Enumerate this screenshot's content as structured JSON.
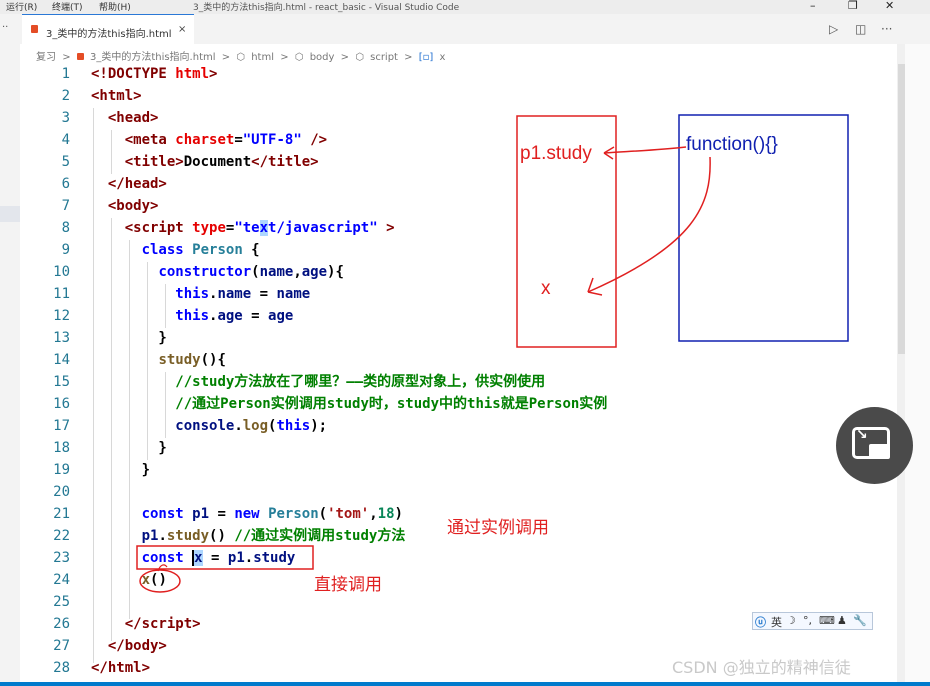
{
  "window": {
    "menu": [
      "运行(R)",
      "终端(T)",
      "帮助(H)"
    ],
    "title": "3_类中的方法this指向.html - react_basic - Visual Studio Code"
  },
  "tab": {
    "label": "3_类中的方法this指向.html",
    "close": "×"
  },
  "breadcrumb": [
    "复习",
    ">",
    "3_类中的方法this指向.html",
    ">",
    "html",
    ">",
    "body",
    ">",
    "script",
    ">",
    "x"
  ],
  "code_lines": [
    {
      "n": "1",
      "html": "<span class='t'>&lt;!DOCTYPE </span><span class='a'>html</span><span class='t'>&gt;</span>"
    },
    {
      "n": "2",
      "html": "<span class='t'>&lt;html&gt;</span>"
    },
    {
      "n": "3",
      "html": "  <span class='t'>&lt;head&gt;</span>"
    },
    {
      "n": "4",
      "html": "    <span class='t'>&lt;meta </span><span class='a'>charset</span>=<span class='k'>\"UTF-8\"</span> <span class='t'>/&gt;</span>"
    },
    {
      "n": "5",
      "html": "    <span class='t'>&lt;title&gt;</span>Document<span class='t'>&lt;/title&gt;</span>"
    },
    {
      "n": "6",
      "html": "  <span class='t'>&lt;/head&gt;</span>"
    },
    {
      "n": "7",
      "html": "  <span class='t'>&lt;body&gt;</span>"
    },
    {
      "n": "8",
      "html": "    <span class='t'>&lt;script </span><span class='a'>type</span>=<span class='k'>\"te<span class='sel'>x</span>t/javascript\"</span> <span class='t'>&gt;</span>"
    },
    {
      "n": "9",
      "html": "      <span class='k'>class</span> <span class='ty'>Person</span> {"
    },
    {
      "n": "10",
      "html": "        <span class='k'>constructor</span>(<span class='v'>name</span>,<span class='v'>age</span>){"
    },
    {
      "n": "11",
      "html": "          <span class='k'>this</span>.<span class='v'>name</span> = <span class='v'>name</span>"
    },
    {
      "n": "12",
      "html": "          <span class='k'>this</span>.<span class='v'>age</span> = <span class='v'>age</span>"
    },
    {
      "n": "13",
      "html": "        }"
    },
    {
      "n": "14",
      "html": "        <span class='f'>study</span>(){"
    },
    {
      "n": "15",
      "html": "          <span class='c'>//study方法放在了哪里？——类的原型对象上，供实例使用</span>"
    },
    {
      "n": "16",
      "html": "          <span class='c'>//通过Person实例调用study时，study中的this就是Person实例</span>"
    },
    {
      "n": "17",
      "html": "          <span class='v'>console</span>.<span class='f'>log</span>(<span class='k'>this</span>);"
    },
    {
      "n": "18",
      "html": "        }"
    },
    {
      "n": "19",
      "html": "      }"
    },
    {
      "n": "20",
      "html": ""
    },
    {
      "n": "21",
      "html": "      <span class='k'>const</span> <span class='v'>p1</span> = <span class='k'>new</span> <span class='ty'>Person</span>(<span class='s'>'tom'</span>,<span class='n'>18</span>)"
    },
    {
      "n": "22",
      "html": "      <span class='v'>p1</span>.<span class='f'>study</span>() <span class='c'>//通过实例调用study方法</span>"
    },
    {
      "n": "23",
      "html": "      <span class='k'>const</span> <span class='caret'></span><span class='sel v'>x</span> = <span class='v'>p1</span>.<span class='v'>study</span>"
    },
    {
      "n": "24",
      "html": "      <span class='f'>x</span>()"
    },
    {
      "n": "25",
      "html": ""
    },
    {
      "n": "26",
      "html": "    <span class='t'>&lt;/script&gt;</span>"
    },
    {
      "n": "27",
      "html": "  <span class='t'>&lt;/body&gt;</span>"
    },
    {
      "n": "28",
      "html": "<span class='t'>&lt;/html&gt;</span>"
    }
  ],
  "annotations": {
    "box_left_label_top": "p1.study",
    "box_left_label_bottom": "x",
    "box_right_label": "function(){}",
    "instance_call": "通过实例调用",
    "direct_call": "直接调用",
    "red": "#e02020",
    "blue": "#1020b0"
  },
  "ime_bar": [
    "英",
    "☽",
    "°,",
    "⌨",
    "♟",
    "🔧"
  ],
  "watermark": "CSDN @独立的精神信徒"
}
